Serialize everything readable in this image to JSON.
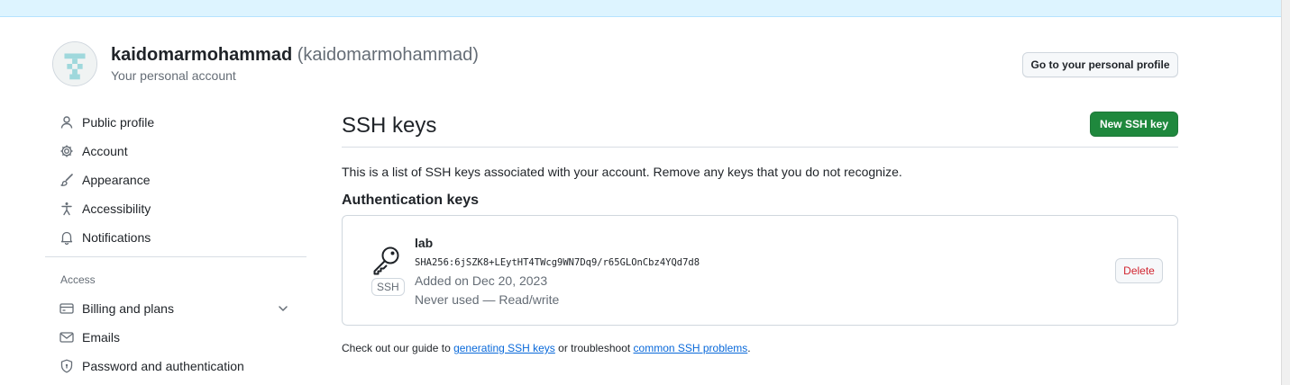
{
  "header": {
    "username": "kaidomarmohammad",
    "handle": "(kaidomarmohammad)",
    "subtitle": "Your personal account",
    "profile_button": "Go to your personal profile"
  },
  "sidebar": {
    "items": [
      {
        "label": "Public profile",
        "icon": "person-icon"
      },
      {
        "label": "Account",
        "icon": "gear-icon"
      },
      {
        "label": "Appearance",
        "icon": "paintbrush-icon"
      },
      {
        "label": "Accessibility",
        "icon": "accessibility-icon"
      },
      {
        "label": "Notifications",
        "icon": "bell-icon"
      }
    ],
    "access_heading": "Access",
    "access_items": [
      {
        "label": "Billing and plans",
        "icon": "credit-card-icon",
        "expandable": true
      },
      {
        "label": "Emails",
        "icon": "mail-icon"
      },
      {
        "label": "Password and authentication",
        "icon": "shield-lock-icon"
      }
    ]
  },
  "main": {
    "title": "SSH keys",
    "new_key_button": "New SSH key",
    "intro": "This is a list of SSH keys associated with your account. Remove any keys that you do not recognize.",
    "section_heading": "Authentication keys",
    "keys": [
      {
        "title": "lab",
        "fingerprint": "SHA256:6jSZK8+LEytHT4TWcg9WN7Dq9/r65GLOnCbz4YQd7d8",
        "added": "Added on Dec 20, 2023",
        "usage": "Never used — Read/write",
        "badge": "SSH",
        "delete_label": "Delete"
      }
    ],
    "footer": {
      "prefix": "Check out our guide to ",
      "link1": "generating SSH keys",
      "middle": " or troubleshoot ",
      "link2": "common SSH problems",
      "suffix": "."
    }
  },
  "colors": {
    "primary_button": "#1f883d",
    "danger_text": "#d1242f",
    "link": "#0969da",
    "banner": "#ddf4ff"
  }
}
